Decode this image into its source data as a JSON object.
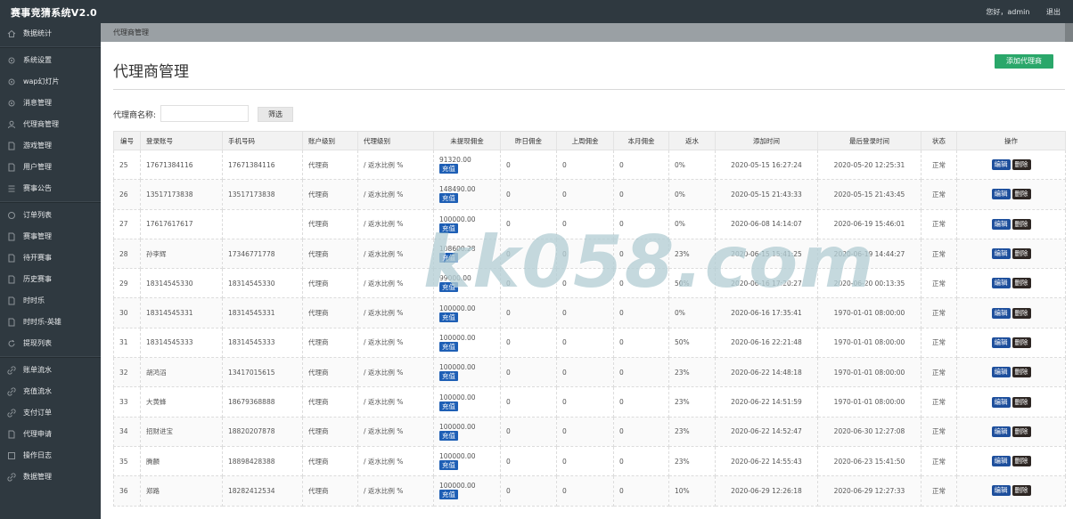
{
  "brand": "赛事竞猜系统V2.0",
  "header": {
    "greeting": "您好，admin",
    "logout": "退出"
  },
  "sidebar": {
    "groups": [
      [
        {
          "label": "数据统计",
          "icon": "home-icon"
        }
      ],
      [
        {
          "label": "系统设置",
          "icon": "gear-icon"
        },
        {
          "label": "wap幻灯片",
          "icon": "gear-icon"
        },
        {
          "label": "消息管理",
          "icon": "gear-icon"
        },
        {
          "label": "代理商管理",
          "icon": "user-icon"
        },
        {
          "label": "游戏管理",
          "icon": "document-icon"
        },
        {
          "label": "用户管理",
          "icon": "document-icon"
        },
        {
          "label": "赛事公告",
          "icon": "list-icon"
        }
      ],
      [
        {
          "label": "订单列表",
          "icon": "circle-icon"
        },
        {
          "label": "赛事管理",
          "icon": "document-icon"
        },
        {
          "label": "待开赛事",
          "icon": "document-icon"
        },
        {
          "label": "历史赛事",
          "icon": "document-icon"
        },
        {
          "label": "时时乐",
          "icon": "document-icon"
        },
        {
          "label": "时时乐-英雄",
          "icon": "document-icon"
        },
        {
          "label": "提现列表",
          "icon": "refresh-icon"
        }
      ],
      [
        {
          "label": "账单流水",
          "icon": "link-icon"
        },
        {
          "label": "充值流水",
          "icon": "link-icon"
        },
        {
          "label": "支付订单",
          "icon": "link-icon"
        },
        {
          "label": "代理申请",
          "icon": "document-icon"
        },
        {
          "label": "操作日志",
          "icon": "square-icon"
        },
        {
          "label": "数据管理",
          "icon": "link-icon"
        }
      ]
    ]
  },
  "breadcrumb": "代理商管理",
  "page": {
    "title": "代理商管理",
    "add_button": "添加代理商"
  },
  "filter": {
    "label": "代理商名称:",
    "value": "",
    "placeholder": "",
    "button": "筛选"
  },
  "table": {
    "headers": [
      "编号",
      "登录账号",
      "手机号码",
      "账户级别",
      "代理级别",
      "未提现佣金",
      "昨日佣金",
      "上周佣金",
      "本月佣金",
      "返水",
      "添加时间",
      "最后登录时间",
      "状态",
      "操作"
    ],
    "recharge_label": "充值",
    "edit_label": "编辑",
    "delete_label": "删除",
    "rows": [
      {
        "id": "25",
        "account": "17671384116",
        "phone": "17671384116",
        "acct_level": "代理商",
        "agent_level": "/ 返水比例 %",
        "unpaid": "91320.00",
        "yesterday": "0",
        "lastweek": "0",
        "month": "0",
        "rebate": "0%",
        "added": "2020-05-15 16:27:24",
        "lastlogin": "2020-05-20 12:25:31",
        "status": "正常"
      },
      {
        "id": "26",
        "account": "13517173838",
        "phone": "13517173838",
        "acct_level": "代理商",
        "agent_level": "/ 返水比例 %",
        "unpaid": "148490.00",
        "yesterday": "0",
        "lastweek": "0",
        "month": "0",
        "rebate": "0%",
        "added": "2020-05-15 21:43:33",
        "lastlogin": "2020-05-15 21:43:45",
        "status": "正常"
      },
      {
        "id": "27",
        "account": "17617617617",
        "phone": "",
        "acct_level": "代理商",
        "agent_level": "/ 返水比例 %",
        "unpaid": "100000.00",
        "yesterday": "0",
        "lastweek": "0",
        "month": "0",
        "rebate": "0%",
        "added": "2020-06-08 14:14:07",
        "lastlogin": "2020-06-19 15:46:01",
        "status": "正常"
      },
      {
        "id": "28",
        "account": "孙李辉",
        "phone": "17346771778",
        "acct_level": "代理商",
        "agent_level": "/ 返水比例 %",
        "unpaid": "108600.28",
        "yesterday": "0",
        "lastweek": "0",
        "month": "0",
        "rebate": "23%",
        "added": "2020-06-15 15:41:25",
        "lastlogin": "2020-06-19 14:44:27",
        "status": "正常"
      },
      {
        "id": "29",
        "account": "18314545330",
        "phone": "18314545330",
        "acct_level": "代理商",
        "agent_level": "/ 返水比例 %",
        "unpaid": "99000.00",
        "yesterday": "0",
        "lastweek": "0",
        "month": "0",
        "rebate": "50%",
        "added": "2020-06-16 17:20:27",
        "lastlogin": "2020-06-20 00:13:35",
        "status": "正常"
      },
      {
        "id": "30",
        "account": "18314545331",
        "phone": "18314545331",
        "acct_level": "代理商",
        "agent_level": "/ 返水比例 %",
        "unpaid": "100000.00",
        "yesterday": "0",
        "lastweek": "0",
        "month": "0",
        "rebate": "0%",
        "added": "2020-06-16 17:35:41",
        "lastlogin": "1970-01-01 08:00:00",
        "status": "正常"
      },
      {
        "id": "31",
        "account": "18314545333",
        "phone": "18314545333",
        "acct_level": "代理商",
        "agent_level": "/ 返水比例 %",
        "unpaid": "100000.00",
        "yesterday": "0",
        "lastweek": "0",
        "month": "0",
        "rebate": "50%",
        "added": "2020-06-16 22:21:48",
        "lastlogin": "1970-01-01 08:00:00",
        "status": "正常"
      },
      {
        "id": "32",
        "account": "胡鸿滔",
        "phone": "13417015615",
        "acct_level": "代理商",
        "agent_level": "/ 返水比例 %",
        "unpaid": "100000.00",
        "yesterday": "0",
        "lastweek": "0",
        "month": "0",
        "rebate": "23%",
        "added": "2020-06-22 14:48:18",
        "lastlogin": "1970-01-01 08:00:00",
        "status": "正常"
      },
      {
        "id": "33",
        "account": "大黄蜂",
        "phone": "18679368888",
        "acct_level": "代理商",
        "agent_level": "/ 返水比例 %",
        "unpaid": "100000.00",
        "yesterday": "0",
        "lastweek": "0",
        "month": "0",
        "rebate": "23%",
        "added": "2020-06-22 14:51:59",
        "lastlogin": "1970-01-01 08:00:00",
        "status": "正常"
      },
      {
        "id": "34",
        "account": "招财进宝",
        "phone": "18820207878",
        "acct_level": "代理商",
        "agent_level": "/ 返水比例 %",
        "unpaid": "100000.00",
        "yesterday": "0",
        "lastweek": "0",
        "month": "0",
        "rebate": "23%",
        "added": "2020-06-22 14:52:47",
        "lastlogin": "2020-06-30 12:27:08",
        "status": "正常"
      },
      {
        "id": "35",
        "account": "腾麟",
        "phone": "18898428388",
        "acct_level": "代理商",
        "agent_level": "/ 返水比例 %",
        "unpaid": "100000.00",
        "yesterday": "0",
        "lastweek": "0",
        "month": "0",
        "rebate": "23%",
        "added": "2020-06-22 14:55:43",
        "lastlogin": "2020-06-23 15:41:50",
        "status": "正常"
      },
      {
        "id": "36",
        "account": "郑路",
        "phone": "18282412534",
        "acct_level": "代理商",
        "agent_level": "/ 返水比例 %",
        "unpaid": "100000.00",
        "yesterday": "0",
        "lastweek": "0",
        "month": "0",
        "rebate": "10%",
        "added": "2020-06-29 12:26:18",
        "lastlogin": "2020-06-29 12:27:33",
        "status": "正常"
      }
    ]
  },
  "watermark": "kk058.com",
  "colors": {
    "sidebar_bg": "#2f3940",
    "add_button": "#2aa76a",
    "recharge_button": "#1e5fb5",
    "edit_button": "#1e4f9c",
    "delete_button": "#2d2623"
  }
}
